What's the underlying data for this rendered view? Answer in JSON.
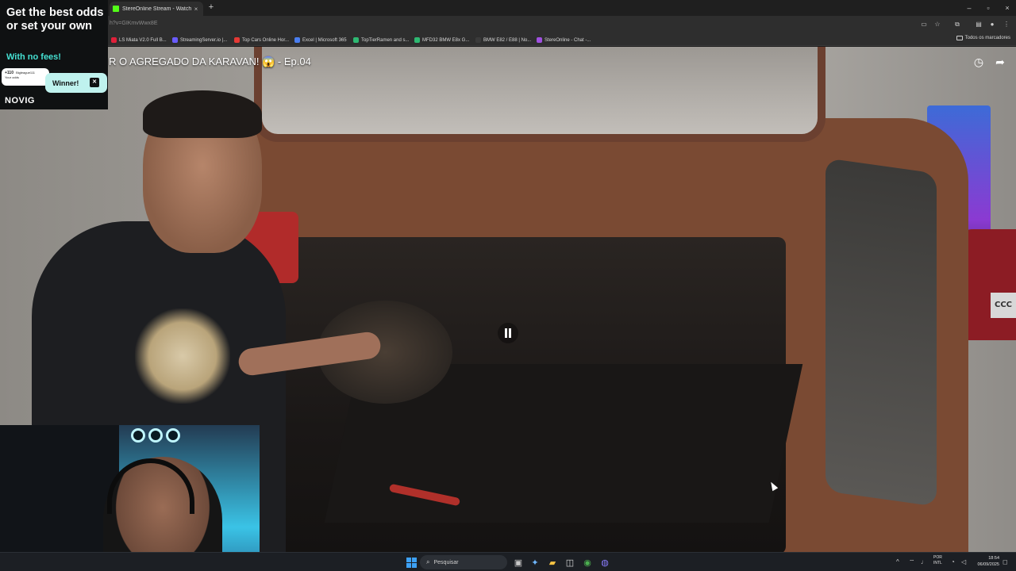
{
  "browser": {
    "tab_title": "StereOnline Stream - Watch Liv",
    "tab_close": "×",
    "new_tab": "+",
    "url": "h?v=GIKmvWwx8E",
    "window_controls": [
      "–",
      "▫",
      "×"
    ],
    "bookmarks": [
      {
        "label": "LS Miata V2.0 Full B...",
        "color": "#e0203a"
      },
      {
        "label": "StreamingServer.io |...",
        "color": "#6a5cff"
      },
      {
        "label": "Top Cars Online Hor...",
        "color": "#e53935"
      },
      {
        "label": "Excel | Microsoft 365",
        "color": "#4a7ef0"
      },
      {
        "label": "TopTierRamen and s...",
        "color": "#2eb872"
      },
      {
        "label": "MFD32 BMW E8x G...",
        "color": "#2eb872"
      },
      {
        "label": "BMW E82 / E88 | No...",
        "color": "#3a3a3a"
      },
      {
        "label": "StereOnline - Chat -...",
        "color": "#a050e0"
      }
    ],
    "all_bookmarks": "Todos os marcadores"
  },
  "video": {
    "title": "R O AGREGADO DA KARAVAN! 😱 - Ep.04",
    "watch_later_icon": "clock-icon",
    "share_icon": "share-icon",
    "plate_text": "CCC"
  },
  "ad": {
    "headline": "Get the best odds or set your own",
    "sub": "With no fees!",
    "card_number": "+110",
    "card_name": "Bigleague111",
    "card_sub": "Your odds",
    "winner": "Winner!",
    "brand": "NOVIG"
  },
  "taskbar": {
    "search_placeholder": "Pesquisar",
    "lang_top": "POR",
    "lang_bottom": "INTL",
    "time": "18:54",
    "date": "06/09/2025"
  },
  "colors": {
    "accent_kick": "#53fc18",
    "ad_teal": "#45e0d2"
  }
}
